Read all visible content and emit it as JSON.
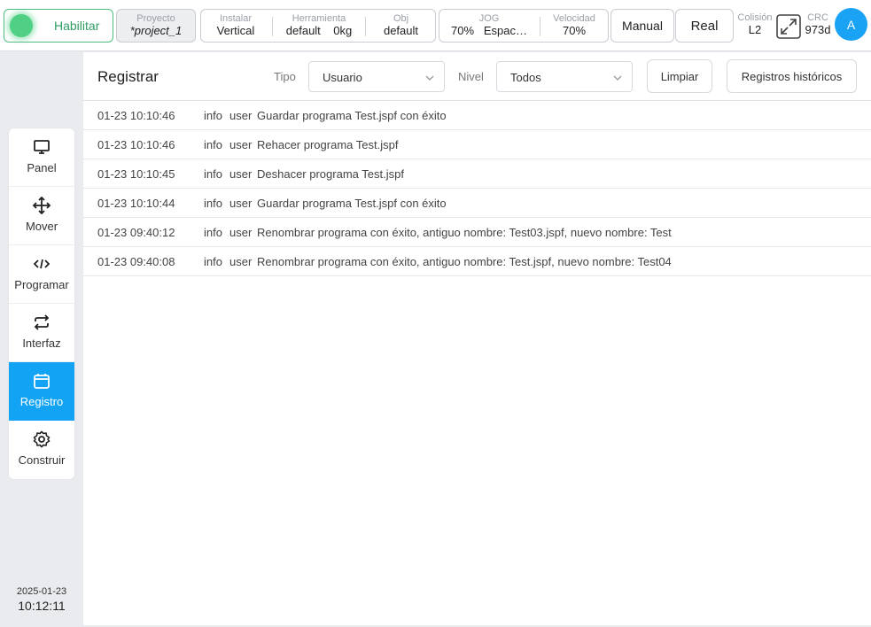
{
  "topbar": {
    "enable_label": "Habilitar",
    "project": {
      "label": "Proyecto",
      "value": "*project_1"
    },
    "install": {
      "label": "Instalar",
      "value": "Vertical"
    },
    "tool": {
      "label": "Herramienta",
      "name": "default",
      "weight": "0kg"
    },
    "obj": {
      "label": "Obj",
      "value": "default"
    },
    "jog": {
      "label": "JOG",
      "percent": "70%",
      "mode": "Espac…"
    },
    "speed": {
      "label": "Velocidad",
      "value": "70%"
    },
    "manual_label": "Manual",
    "real_label": "Real",
    "collision": {
      "label": "Colisión",
      "value": "L2"
    },
    "crc": {
      "label": "CRC",
      "value": "973d"
    },
    "avatar_initial": "A"
  },
  "sidebar": {
    "items": [
      {
        "label": "Panel",
        "icon": "monitor-icon"
      },
      {
        "label": "Mover",
        "icon": "move-arrows-icon"
      },
      {
        "label": "Programar",
        "icon": "code-icon"
      },
      {
        "label": "Interfaz",
        "icon": "swap-icon"
      },
      {
        "label": "Registro",
        "icon": "calendar-icon",
        "active": true
      },
      {
        "label": "Construir",
        "icon": "gear-icon"
      }
    ],
    "date": "2025-01-23",
    "time": "10:12:11"
  },
  "main": {
    "title": "Registrar",
    "type_label": "Tipo",
    "type_value": "Usuario",
    "level_label": "Nivel",
    "level_value": "Todos",
    "clear_label": "Limpiar",
    "history_label": "Registros históricos",
    "logs": [
      {
        "time": "01-23 10:10:46",
        "level": "info",
        "user": "user",
        "message": "Guardar programa Test.jspf con éxito"
      },
      {
        "time": "01-23 10:10:46",
        "level": "info",
        "user": "user",
        "message": "Rehacer programa Test.jspf"
      },
      {
        "time": "01-23 10:10:45",
        "level": "info",
        "user": "user",
        "message": "Deshacer programa Test.jspf"
      },
      {
        "time": "01-23 10:10:44",
        "level": "info",
        "user": "user",
        "message": "Guardar programa Test.jspf con éxito"
      },
      {
        "time": "01-23 09:40:12",
        "level": "info",
        "user": "user",
        "message": "Renombrar programa con éxito, antiguo nombre: Test03.jspf, nuevo nombre: Test"
      },
      {
        "time": "01-23 09:40:08",
        "level": "info",
        "user": "user",
        "message": "Renombrar programa con éxito, antiguo nombre: Test.jspf, nuevo nombre: Test04"
      }
    ]
  },
  "colors": {
    "accent": "#13a3f4",
    "enable_green": "#4fd084"
  }
}
